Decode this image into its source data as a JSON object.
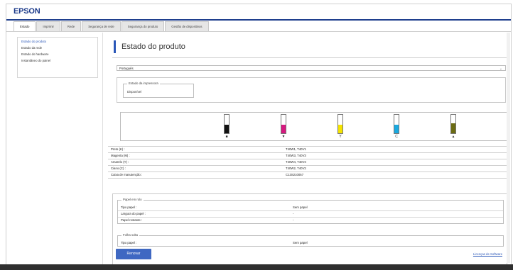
{
  "app": {
    "logo": "EPSON"
  },
  "tabs": [
    {
      "label": "Estado"
    },
    {
      "label": "Imprimir"
    },
    {
      "label": "Rede"
    },
    {
      "label": "Segurança de rede"
    },
    {
      "label": "Segurança do produto"
    },
    {
      "label": "Gestão de dispositivos"
    }
  ],
  "sidebar": {
    "items": [
      {
        "label": "Estado do produto"
      },
      {
        "label": "Estado da rede"
      },
      {
        "label": "Estado do hardware"
      },
      {
        "label": "Instantâneo do painel"
      }
    ]
  },
  "main": {
    "title": "Estado do produto",
    "language_select": {
      "value": "Português"
    },
    "printer_status": {
      "legend": "Estado da impressora",
      "value": "Disponível"
    },
    "inks": [
      {
        "color": "#111111",
        "mark": "■",
        "level": 0.45
      },
      {
        "color": "#d6187f",
        "mark": "▼",
        "level": 0.45
      },
      {
        "color": "#f5e400",
        "mark": "Y",
        "level": 0.45
      },
      {
        "color": "#19a9e0",
        "mark": "C",
        "level": 0.45
      },
      {
        "color": "#6b6b12",
        "mark": "▲",
        "level": 0.55
      }
    ],
    "ink_table": [
      {
        "name": "Preto (K) :",
        "code": "T40W1, T40V1"
      },
      {
        "name": "Magenta (M) :",
        "code": "T40W3, T40V3"
      },
      {
        "name": "Amarelo (Y) :",
        "code": "T40W4, T40V4"
      },
      {
        "name": "Ciano (C) :",
        "code": "T40W2, T40V2"
      },
      {
        "name": "Caixa de manutenção :",
        "code": "C13S210057"
      }
    ],
    "paper_roll": {
      "legend": "Papel em rolo",
      "rows": [
        {
          "label": "Tipo papel :",
          "value": "Sem papel"
        },
        {
          "label": "Largura do papel :",
          "value": "-"
        },
        {
          "label": "Papel restante :",
          "value": "-"
        }
      ]
    },
    "cut_sheet": {
      "legend": "Folha solta",
      "rows": [
        {
          "label": "Tipo papel :",
          "value": "Sem papel"
        }
      ]
    },
    "refresh_label": "Renovar",
    "license_link": "Licenças de Software"
  }
}
